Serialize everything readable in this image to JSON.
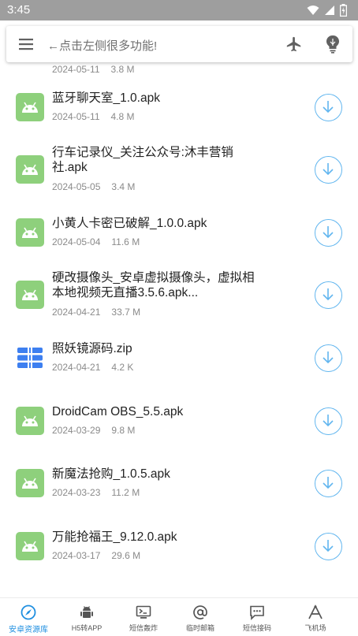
{
  "status_bar": {
    "time": "3:45"
  },
  "search": {
    "placeholder": "←点击左侧很多功能!"
  },
  "files": [
    {
      "name": "",
      "date": "2024-05-11",
      "size": "3.8 M",
      "icon": "android-icon"
    },
    {
      "name": "蓝牙聊天室_1.0.apk",
      "date": "2024-05-11",
      "size": "4.8 M",
      "icon": "android-icon"
    },
    {
      "name": "行车记录仪_关注公众号:沐丰营销社.apk",
      "date": "2024-05-05",
      "size": "3.4 M",
      "icon": "android-icon"
    },
    {
      "name": "小黄人卡密已破解_1.0.0.apk",
      "date": "2024-05-04",
      "size": "11.6 M",
      "icon": "android-icon"
    },
    {
      "name": "硬改摄像头_安卓虚拟摄像头，虚拟相本地视频无直播3.5.6.apk...",
      "date": "2024-04-21",
      "size": "33.7 M",
      "icon": "android-icon"
    },
    {
      "name": "照妖镜源码.zip",
      "date": "2024-04-21",
      "size": "4.2 K",
      "icon": "zip-icon"
    },
    {
      "name": "DroidCam OBS_5.5.apk",
      "date": "2024-03-29",
      "size": "9.8 M",
      "icon": "android-icon"
    },
    {
      "name": "新魔法抢购_1.0.5.apk",
      "date": "2024-03-23",
      "size": "11.2 M",
      "icon": "android-icon"
    },
    {
      "name": "万能抢福王_9.12.0.apk",
      "date": "2024-03-17",
      "size": "29.6 M",
      "icon": "android-icon"
    }
  ],
  "bottom_nav": [
    {
      "label": "安卓资源库",
      "icon": "compass-icon",
      "active": true
    },
    {
      "label": "H5转APP",
      "icon": "android-robot-icon",
      "active": false
    },
    {
      "label": "短信轰炸",
      "icon": "terminal-icon",
      "active": false
    },
    {
      "label": "临时邮箱",
      "icon": "at-icon",
      "active": false
    },
    {
      "label": "短信接码",
      "icon": "sms-icon",
      "active": false
    },
    {
      "label": "飞机场",
      "icon": "plane-icon",
      "active": false
    }
  ],
  "colors": {
    "accent": "#1f8fe0",
    "android_icon_bg": "#8ed07c",
    "download_ring": "#62b6ef",
    "status_bar": "#9e9e9e"
  }
}
